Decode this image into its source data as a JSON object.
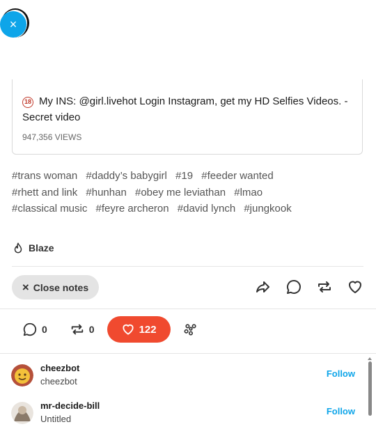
{
  "close_button": {
    "label": "×"
  },
  "post_card": {
    "badge": "18",
    "title": "My INS: @girl.livehot Login Instagram, get my HD Selfies Videos. - Secret video",
    "views": "947,356 VIEWS"
  },
  "tags": [
    "#trans woman",
    "#daddy’s babygirl",
    "#19",
    "#feeder wanted",
    "#rhett and link",
    "#hunhan",
    "#obey me leviathan",
    "#lmao",
    "#classical music",
    "#feyre archeron",
    "#david lynch",
    "#jungkook"
  ],
  "blaze": {
    "label": "Blaze"
  },
  "close_notes": {
    "icon": "×",
    "label": "Close notes"
  },
  "notes_tabs": {
    "replies": "0",
    "reblogs": "0",
    "likes": "122"
  },
  "notes": [
    {
      "username": "cheezbot",
      "subtitle": "cheezbot",
      "action": "Follow"
    },
    {
      "username": "mr-decide-bill",
      "subtitle": "Untitled",
      "action": "Follow"
    }
  ],
  "colors": {
    "accent": "#0ea5e9",
    "like": "#f04a2f"
  }
}
